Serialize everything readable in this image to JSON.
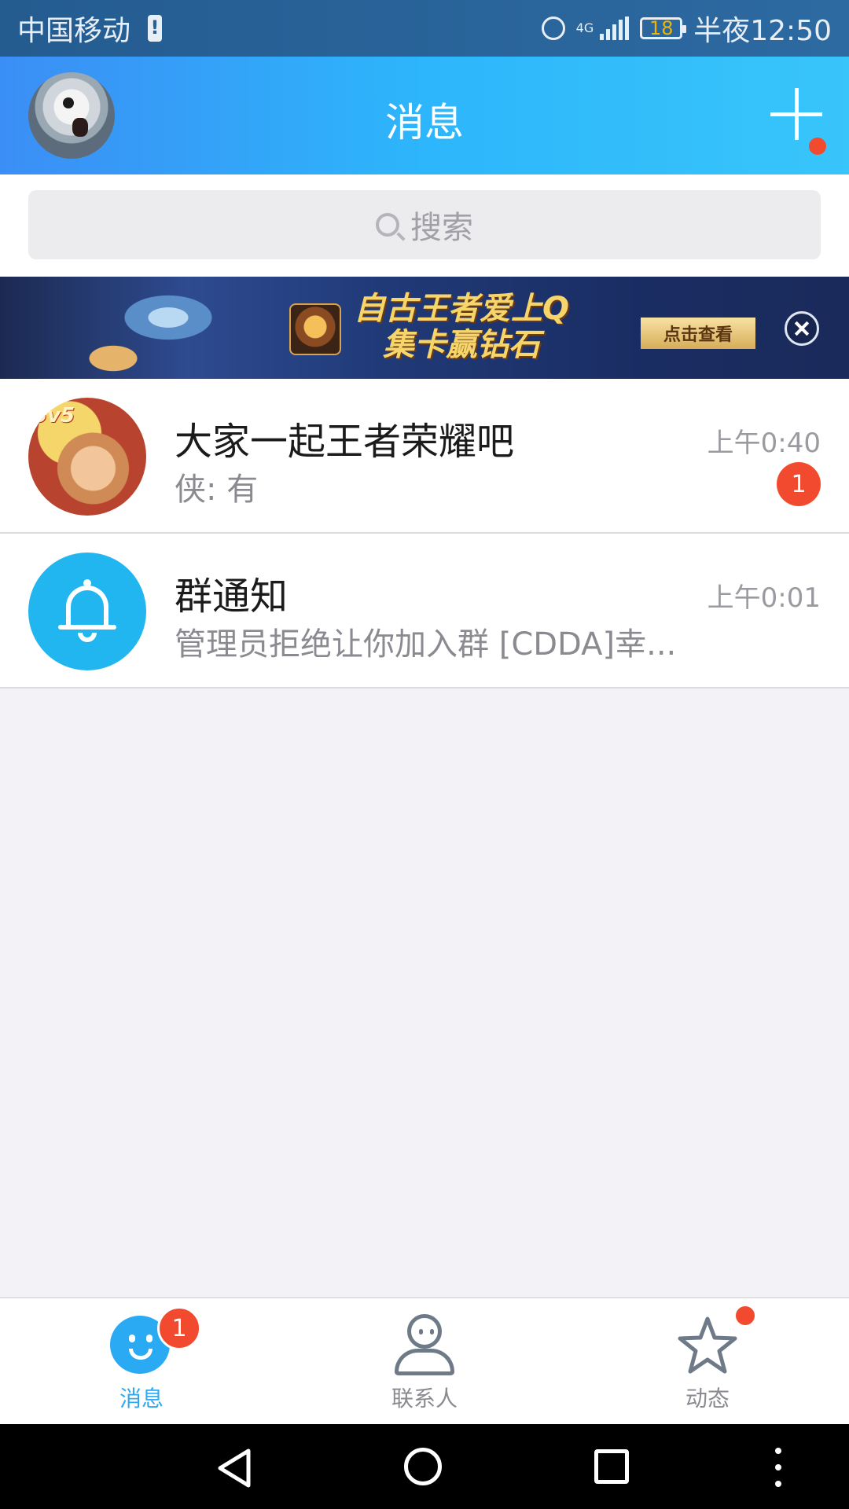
{
  "status_bar": {
    "carrier": "中国移动",
    "network": "4G",
    "battery": "18",
    "time": "半夜12:50"
  },
  "header": {
    "title": "消息"
  },
  "search": {
    "placeholder": "搜索"
  },
  "banner": {
    "line1": "自古王者爱上Q",
    "line2": "集卡赢钻石",
    "button": "点击查看",
    "logo_text": "5v5"
  },
  "chats": [
    {
      "title": "大家一起王者荣耀吧",
      "preview": "侠: 有",
      "time": "上午0:40",
      "unread": "1"
    },
    {
      "title": "群通知",
      "preview": "管理员拒绝让你加入群 [CDDA]幸...",
      "time": "上午0:01"
    }
  ],
  "tabs": {
    "messages": {
      "label": "消息",
      "badge": "1"
    },
    "contacts": {
      "label": "联系人"
    },
    "moments": {
      "label": "动态"
    }
  },
  "icons": {
    "search": "search-icon",
    "add": "plus-icon",
    "close": "close-icon",
    "bell": "bell-icon",
    "back": "back-icon",
    "home": "home-icon",
    "recent": "recent-apps-icon",
    "menu": "more-icon"
  },
  "colors": {
    "accent": "#2aaaf2",
    "badge": "#f24a2e",
    "header_start": "#3b8ef5",
    "header_end": "#38c5fa"
  }
}
